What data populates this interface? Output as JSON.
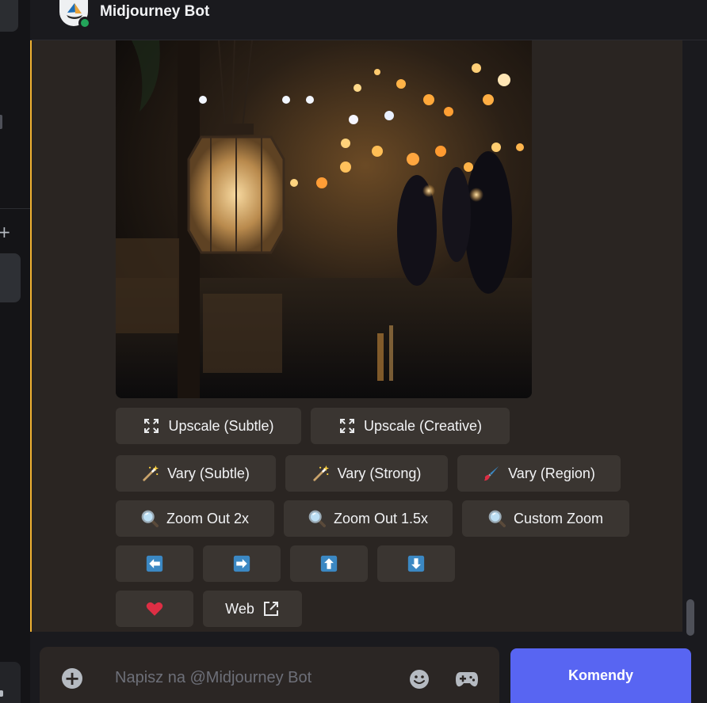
{
  "header": {
    "title": "Midjourney Bot"
  },
  "image": {
    "alt": "lantern-market-image"
  },
  "buttons": {
    "row1": [
      {
        "label": "Upscale (Subtle)",
        "icon": "expand-icon"
      },
      {
        "label": "Upscale (Creative)",
        "icon": "expand-icon"
      }
    ],
    "row2": [
      {
        "label": "Vary (Subtle)",
        "icon": "magic-wand-icon"
      },
      {
        "label": "Vary (Strong)",
        "icon": "magic-wand-icon"
      },
      {
        "label": "Vary (Region)",
        "icon": "paintbrush-icon"
      }
    ],
    "row3": [
      {
        "label": "Zoom Out 2x",
        "icon": "magnifier-icon"
      },
      {
        "label": "Zoom Out 1.5x",
        "icon": "magnifier-icon"
      },
      {
        "label": "Custom Zoom",
        "icon": "magnifier-icon"
      }
    ],
    "row4": [
      {
        "icon": "arrow-left-icon"
      },
      {
        "icon": "arrow-right-icon"
      },
      {
        "icon": "arrow-up-icon"
      },
      {
        "icon": "arrow-down-icon"
      }
    ],
    "row5": [
      {
        "icon": "heart-icon"
      },
      {
        "label": "Web",
        "icon": "external-link-icon"
      }
    ]
  },
  "composer": {
    "placeholder": "Napisz na @Midjourney Bot",
    "commands_label": "Komendy"
  },
  "colors": {
    "accent": "#5865f2",
    "online": "#23a55a",
    "highlight_border": "#f0b232",
    "heart": "#dd2e44",
    "arrow_tile": "#3b88c3"
  }
}
